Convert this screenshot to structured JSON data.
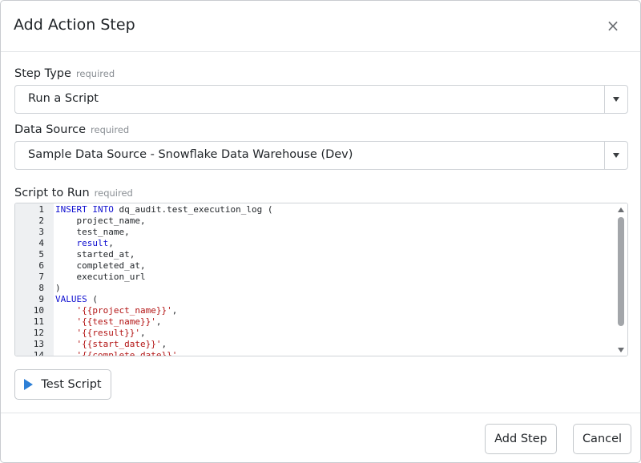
{
  "dialog": {
    "title": "Add Action Step",
    "close_glyph": "×"
  },
  "fields": {
    "step_type": {
      "label": "Step Type",
      "required_text": "required",
      "value": "Run a Script"
    },
    "data_source": {
      "label": "Data Source",
      "required_text": "required",
      "value": "Sample Data Source - Snowflake Data Warehouse (Dev)"
    },
    "script": {
      "label": "Script to Run",
      "required_text": "required"
    }
  },
  "editor": {
    "lines": [
      {
        "n": "1",
        "tokens": [
          {
            "t": "INSERT INTO",
            "c": "kw"
          },
          {
            "t": " dq_audit.test_execution_log ",
            "c": "punc"
          },
          {
            "t": "(",
            "c": "punc"
          }
        ]
      },
      {
        "n": "2",
        "tokens": [
          {
            "t": "    project_name,",
            "c": "punc"
          }
        ]
      },
      {
        "n": "3",
        "tokens": [
          {
            "t": "    test_name,",
            "c": "punc"
          }
        ]
      },
      {
        "n": "4",
        "tokens": [
          {
            "t": "    ",
            "c": "punc"
          },
          {
            "t": "result",
            "c": "kw"
          },
          {
            "t": ",",
            "c": "punc"
          }
        ]
      },
      {
        "n": "5",
        "tokens": [
          {
            "t": "    started_at,",
            "c": "punc"
          }
        ]
      },
      {
        "n": "6",
        "tokens": [
          {
            "t": "    completed_at,",
            "c": "punc"
          }
        ]
      },
      {
        "n": "7",
        "tokens": [
          {
            "t": "    execution_url",
            "c": "punc"
          }
        ]
      },
      {
        "n": "8",
        "tokens": [
          {
            "t": ")",
            "c": "punc"
          }
        ]
      },
      {
        "n": "9",
        "tokens": [
          {
            "t": "VALUES",
            "c": "kw"
          },
          {
            "t": " (",
            "c": "punc"
          }
        ]
      },
      {
        "n": "10",
        "tokens": [
          {
            "t": "    ",
            "c": "punc"
          },
          {
            "t": "'{{project_name}}'",
            "c": "str"
          },
          {
            "t": ",",
            "c": "punc"
          }
        ]
      },
      {
        "n": "11",
        "tokens": [
          {
            "t": "    ",
            "c": "punc"
          },
          {
            "t": "'{{test_name}}'",
            "c": "str"
          },
          {
            "t": ",",
            "c": "punc"
          }
        ]
      },
      {
        "n": "12",
        "tokens": [
          {
            "t": "    ",
            "c": "punc"
          },
          {
            "t": "'{{result}}'",
            "c": "str"
          },
          {
            "t": ",",
            "c": "punc"
          }
        ]
      },
      {
        "n": "13",
        "tokens": [
          {
            "t": "    ",
            "c": "punc"
          },
          {
            "t": "'{{start_date}}'",
            "c": "str"
          },
          {
            "t": ",",
            "c": "punc"
          }
        ]
      },
      {
        "n": "14",
        "tokens": [
          {
            "t": "    ",
            "c": "punc"
          },
          {
            "t": "'{{complete_date}}'",
            "c": "str"
          },
          {
            "t": ",",
            "c": "punc"
          }
        ]
      }
    ]
  },
  "buttons": {
    "test_script": "Test Script",
    "add_step": "Add Step",
    "cancel": "Cancel"
  },
  "colors": {
    "keyword": "#1010d0",
    "string": "#b31414",
    "play_icon": "#2d7fd6"
  }
}
